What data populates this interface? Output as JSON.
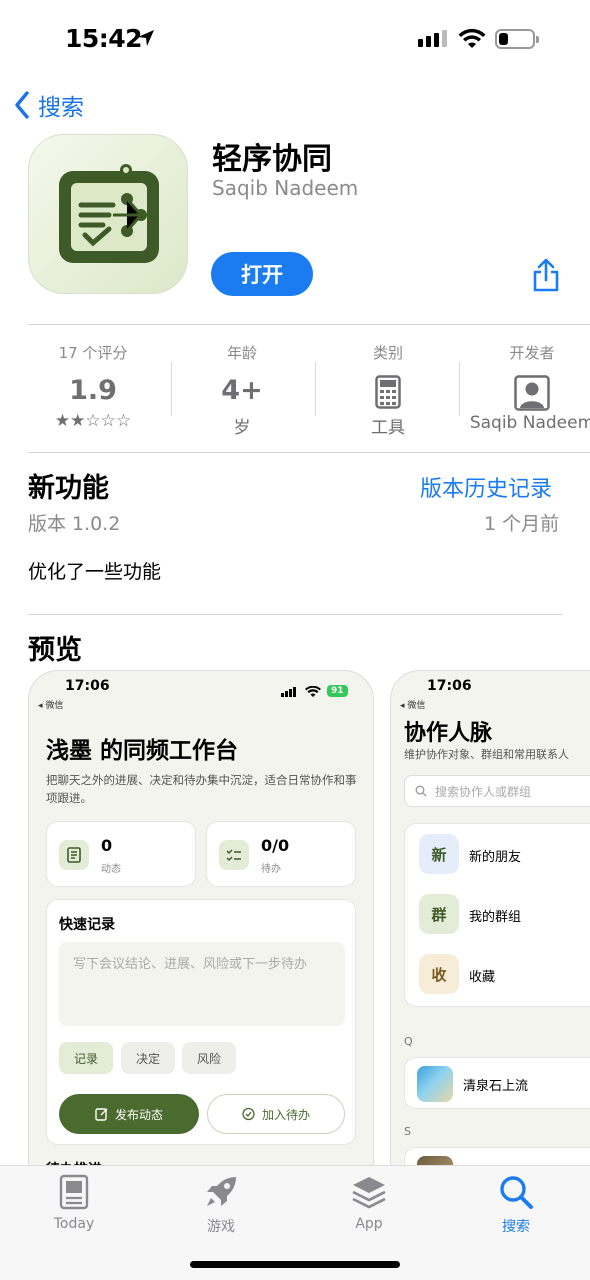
{
  "status": {
    "time": "15:42"
  },
  "nav": {
    "back": "搜索"
  },
  "app": {
    "name": "轻序协同",
    "developer": "Saqib Nadeem",
    "open": "打开"
  },
  "info": {
    "ratings_label": "17 个评分",
    "rating": "1.9",
    "stars": "★★☆☆☆",
    "age_label": "年龄",
    "age": "4+",
    "age_unit": "岁",
    "category_label": "类别",
    "category": "工具",
    "developer_label": "开发者",
    "developer": "Saqib Nadeem"
  },
  "whatsnew": {
    "title": "新功能",
    "history": "版本历史记录",
    "version": "版本 1.0.2",
    "ago": "1 个月前",
    "notes": "优化了一些功能"
  },
  "preview": {
    "title": "预览"
  },
  "shot1": {
    "time": "17:06",
    "back": "◂ 微信",
    "battery": "91",
    "title": "浅墨 的同频工作台",
    "desc": "把聊天之外的进展、决定和待办集中沉淀，适合日常协作和事项跟进。",
    "stat1_value": "0",
    "stat1_label": "动态",
    "stat2_value": "0/0",
    "stat2_label": "待办",
    "quick_title": "快速记录",
    "quick_placeholder": "写下会议结论、进展、风险或下一步待办",
    "chip1": "记录",
    "chip2": "决定",
    "chip3": "风险",
    "publish": "发布动态",
    "add_todo": "加入待办",
    "bottom_cut": "待办推进"
  },
  "shot2": {
    "time": "17:06",
    "back": "◂ 微信",
    "title": "协作人脉",
    "desc": "维护协作对象、群组和常用联系人",
    "search_placeholder": "搜索协作人或群组",
    "item1_badge": "新",
    "item1": "新的朋友",
    "item2_badge": "群",
    "item2": "我的群组",
    "item3_badge": "收",
    "item3": "收藏",
    "section_q": "Q",
    "contact1": "清泉石上流",
    "section_s": "S"
  },
  "tabs": {
    "today": "Today",
    "games": "游戏",
    "apps": "App",
    "search": "搜索"
  },
  "colors": {
    "accent": "#1a7cf0",
    "brand_green": "#4a6b2e"
  }
}
